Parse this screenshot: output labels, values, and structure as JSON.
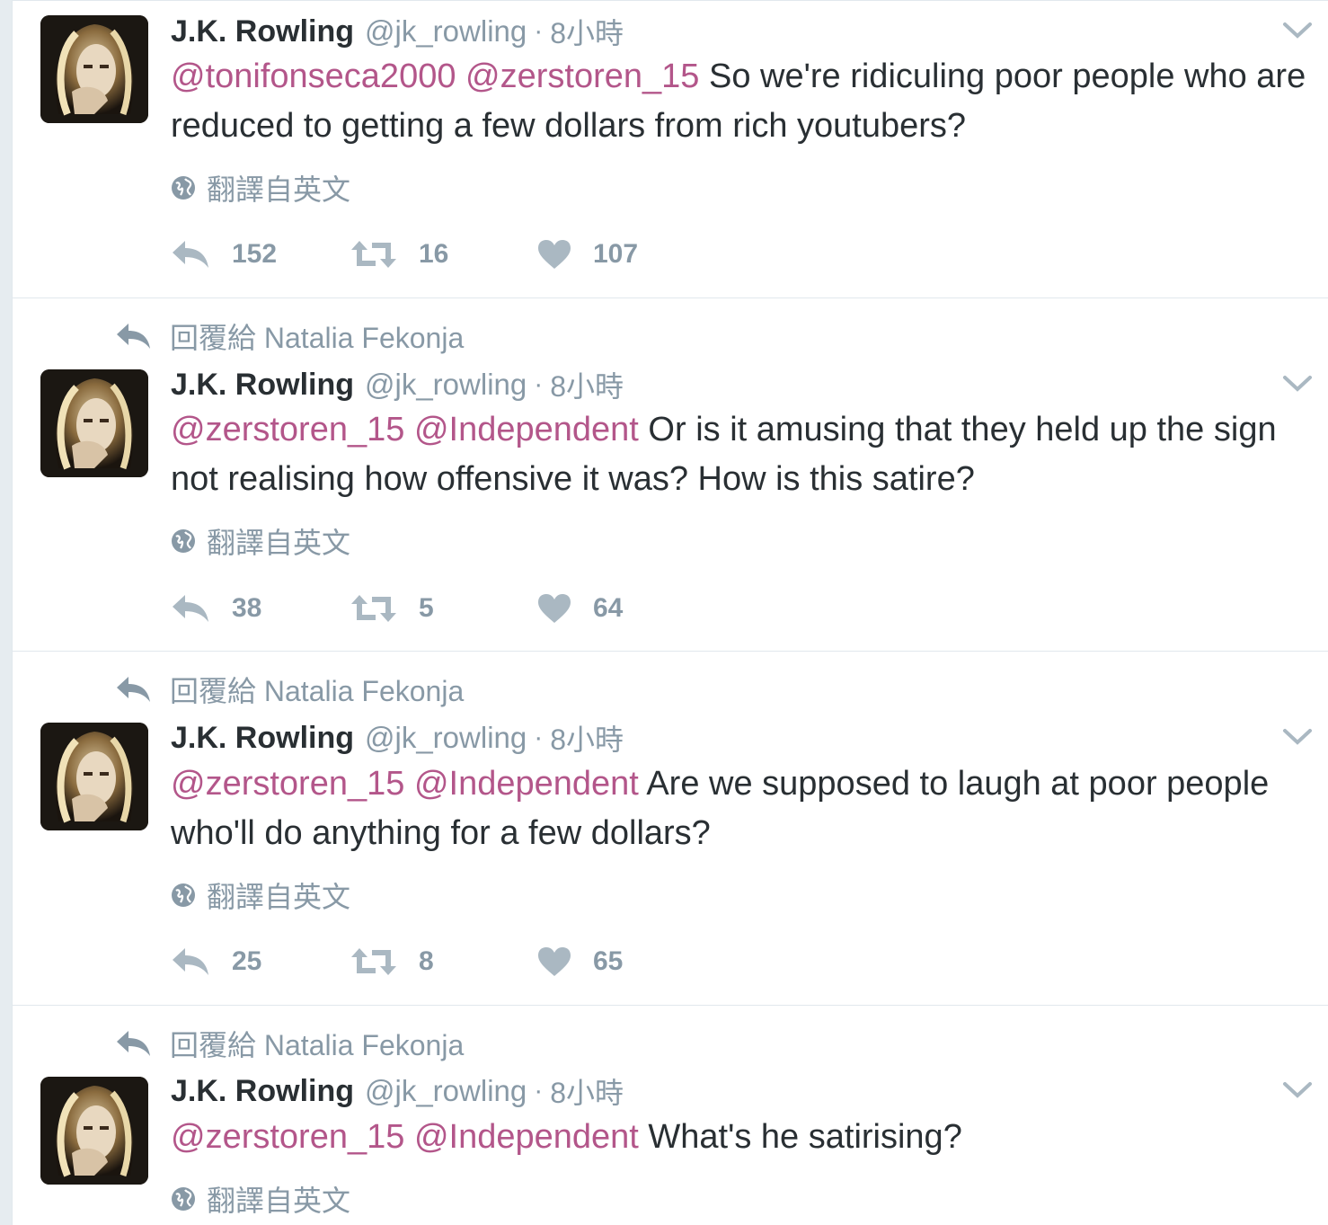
{
  "colors": {
    "mention": "#b3568a",
    "meta": "#8899a6",
    "text": "#292f33"
  },
  "tweets": [
    {
      "reply_to": "",
      "author": {
        "name": "J.K. Rowling",
        "handle": "@jk_rowling"
      },
      "time": "8小時",
      "mentions": [
        "@tonifonseca2000",
        "@zerstoren_15"
      ],
      "body": "So we're ridiculing poor people who are reduced to getting a few dollars from rich youtubers?",
      "translate": "翻譯自英文",
      "stats": {
        "replies": "152",
        "retweets": "16",
        "likes": "107"
      }
    },
    {
      "reply_to": "回覆給 Natalia Fekonja",
      "author": {
        "name": "J.K. Rowling",
        "handle": "@jk_rowling"
      },
      "time": "8小時",
      "mentions": [
        "@zerstoren_15",
        "@Independent"
      ],
      "body": "Or is it amusing that they held up the sign not realising how offensive it was? How is this satire?",
      "translate": "翻譯自英文",
      "stats": {
        "replies": "38",
        "retweets": "5",
        "likes": "64"
      }
    },
    {
      "reply_to": "回覆給 Natalia Fekonja",
      "author": {
        "name": "J.K. Rowling",
        "handle": "@jk_rowling"
      },
      "time": "8小時",
      "mentions": [
        "@zerstoren_15",
        "@Independent"
      ],
      "body": "Are we supposed to laugh at poor people who'll do anything for a few dollars?",
      "translate": "翻譯自英文",
      "stats": {
        "replies": "25",
        "retweets": "8",
        "likes": "65"
      }
    },
    {
      "reply_to": "回覆給 Natalia Fekonja",
      "author": {
        "name": "J.K. Rowling",
        "handle": "@jk_rowling"
      },
      "time": "8小時",
      "mentions": [
        "@zerstoren_15",
        "@Independent"
      ],
      "body": "What's he satirising?",
      "translate": "翻譯自英文",
      "stats": null
    }
  ]
}
